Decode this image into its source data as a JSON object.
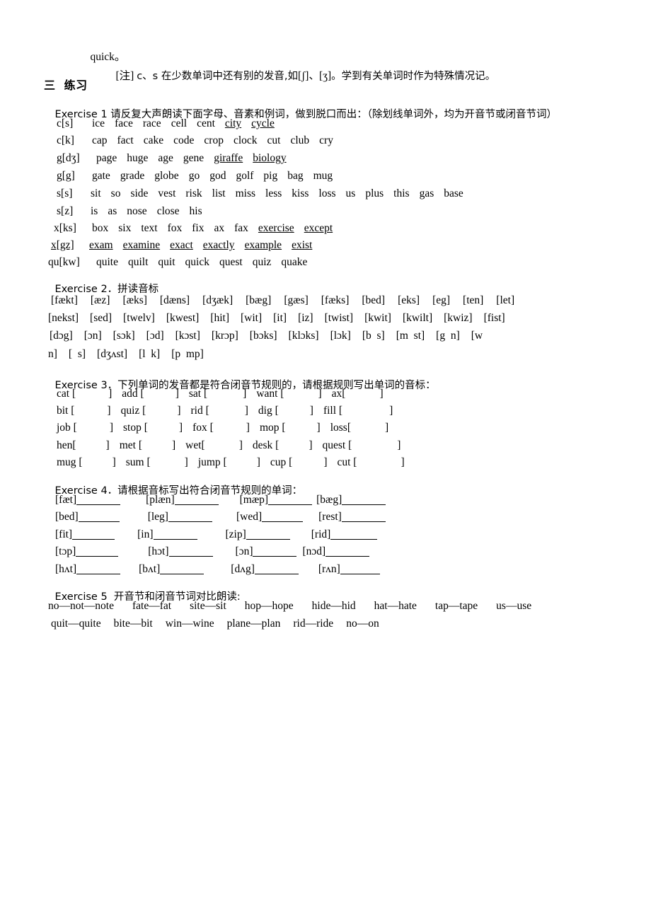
{
  "document": {
    "top_line": "quick。",
    "note": {
      "prefix": "[注] ",
      "text_1": "c、s 在少数单词中还有别的发音,如",
      "symbol_1": "[ʃ]",
      "mid": "、",
      "symbol_2": "[ʒ]",
      "text_2": "。学到有关单词时作为特殊情况记。"
    },
    "section_heading": "三  练习"
  },
  "exercise1": {
    "heading": "Exercise 1 请反复大声朗读下面字母、音素和例词，做到脱口而出：（除划线单词外，均为开音节或闭音节词）",
    "rows": [
      {
        "tag": "c[s]",
        "words": [
          {
            "text": "ice",
            "underline": false
          },
          {
            "text": "face",
            "underline": false
          },
          {
            "text": "race",
            "underline": false
          },
          {
            "text": "cell",
            "underline": false
          },
          {
            "text": "cent",
            "underline": false
          },
          {
            "text": "city",
            "underline": true
          },
          {
            "text": "cycle",
            "underline": true
          }
        ]
      },
      {
        "tag": "c[k]",
        "words": [
          {
            "text": "cap",
            "underline": false
          },
          {
            "text": "fact",
            "underline": false
          },
          {
            "text": "cake",
            "underline": false
          },
          {
            "text": "code",
            "underline": false
          },
          {
            "text": "crop",
            "underline": false
          },
          {
            "text": "clock",
            "underline": false
          },
          {
            "text": "cut",
            "underline": false
          },
          {
            "text": "club",
            "underline": false
          },
          {
            "text": "cry",
            "underline": false
          }
        ]
      },
      {
        "tag": "g[dʒ]",
        "words": [
          {
            "text": "page",
            "underline": false
          },
          {
            "text": "huge",
            "underline": false
          },
          {
            "text": "age",
            "underline": false
          },
          {
            "text": "gene",
            "underline": false
          },
          {
            "text": "giraffe",
            "underline": true
          },
          {
            "text": "biology",
            "underline": true
          }
        ]
      },
      {
        "tag": "g[g]",
        "words": [
          {
            "text": "gate",
            "underline": false
          },
          {
            "text": "grade",
            "underline": false
          },
          {
            "text": "globe",
            "underline": false
          },
          {
            "text": "go",
            "underline": false
          },
          {
            "text": "god",
            "underline": false
          },
          {
            "text": "golf",
            "underline": false
          },
          {
            "text": "pig",
            "underline": false
          },
          {
            "text": "bag",
            "underline": false
          },
          {
            "text": "mug",
            "underline": false
          }
        ]
      },
      {
        "tag": "s[s]",
        "words": [
          {
            "text": "sit",
            "underline": false
          },
          {
            "text": "so",
            "underline": false
          },
          {
            "text": "side",
            "underline": false
          },
          {
            "text": "vest",
            "underline": false
          },
          {
            "text": "risk",
            "underline": false
          },
          {
            "text": "list",
            "underline": false
          },
          {
            "text": "miss",
            "underline": false
          },
          {
            "text": "less",
            "underline": false
          },
          {
            "text": "kiss",
            "underline": false
          },
          {
            "text": "loss",
            "underline": false
          },
          {
            "text": "us",
            "underline": false
          },
          {
            "text": "plus",
            "underline": false
          },
          {
            "text": "this",
            "underline": false
          },
          {
            "text": "gas",
            "underline": false
          },
          {
            "text": "base",
            "underline": false
          }
        ]
      },
      {
        "tag": "s[z]",
        "words": [
          {
            "text": "is",
            "underline": false
          },
          {
            "text": "as",
            "underline": false
          },
          {
            "text": "nose",
            "underline": false
          },
          {
            "text": "close",
            "underline": false
          },
          {
            "text": "his",
            "underline": false
          }
        ]
      },
      {
        "tag": "x[ks]",
        "words": [
          {
            "text": "box",
            "underline": false
          },
          {
            "text": "six",
            "underline": false
          },
          {
            "text": "text",
            "underline": false
          },
          {
            "text": "fox",
            "underline": false
          },
          {
            "text": "fix",
            "underline": false
          },
          {
            "text": "ax",
            "underline": false
          },
          {
            "text": "fax",
            "underline": false
          },
          {
            "text": "exercise",
            "underline": true
          },
          {
            "text": "except",
            "underline": true
          }
        ]
      },
      {
        "tag": "x[gz]",
        "tag_underline": true,
        "words": [
          {
            "text": "exam",
            "underline": true
          },
          {
            "text": "examine",
            "underline": true
          },
          {
            "text": "exact",
            "underline": true
          },
          {
            "text": "exactly",
            "underline": true
          },
          {
            "text": "example",
            "underline": true
          },
          {
            "text": "exist",
            "underline": true
          }
        ]
      },
      {
        "tag": "qu[kw]",
        "words": [
          {
            "text": "quite",
            "underline": false
          },
          {
            "text": "quilt",
            "underline": false
          },
          {
            "text": "quit",
            "underline": false
          },
          {
            "text": "quick",
            "underline": false
          },
          {
            "text": "quest",
            "underline": false
          },
          {
            "text": "quiz",
            "underline": false
          },
          {
            "text": "quake",
            "underline": false
          }
        ]
      }
    ]
  },
  "exercise2": {
    "heading": "Exercise 2．拼读音标",
    "rows": [
      [
        "[fækt]",
        "[æz]",
        "[æks]",
        "[dæns]",
        "[dʒæk]",
        "[bæg]",
        "[gæs]",
        "[fæks]",
        "[bed]",
        "[eks]",
        "[eg]",
        "[ten]",
        "[let]"
      ],
      [
        "[nekst]",
        "[sed]",
        "[twelv]",
        "[kwest]",
        "[hit]",
        "[wit]",
        "[it]",
        "[iz]",
        "[twist]",
        "[kwit]",
        "[kwilt]",
        "[kwiz]",
        "[fist]"
      ],
      [
        "[dɔg]",
        "[ɔn]",
        "[sɔk]",
        "[ɔd]",
        "[kɔst]",
        "[krɔp]",
        "[bɔks]",
        "[klɔks]",
        "[lɔk]",
        "[b  s]",
        "[m  st]",
        "[g  n]",
        "[w"
      ],
      [
        "n]",
        "[  s]",
        "[dʒʌst]",
        "[l  k]",
        "[p  mp]"
      ]
    ]
  },
  "exercise3": {
    "heading": "Exercise 3．下列单词的发音都是符合闭音节规则的，请根据规则写出单词的音标：",
    "rows": [
      [
        {
          "word": "cat [",
          "gap": 46,
          "close": "]"
        },
        {
          "word": "add [",
          "gap": 44,
          "close": "]"
        },
        {
          "word": "sat [",
          "gap": 50,
          "close": "]"
        },
        {
          "word": "want [",
          "gap": 48,
          "close": "]"
        },
        {
          "word": "ax[",
          "gap": 48,
          "close": "]"
        }
      ],
      [
        {
          "word": "bit [",
          "gap": 46,
          "close": "]"
        },
        {
          "word": "quiz [",
          "gap": 44,
          "close": "]"
        },
        {
          "word": "rid [",
          "gap": 50,
          "close": "]"
        },
        {
          "word": "dig [",
          "gap": 44,
          "close": "]"
        },
        {
          "word": "fill [",
          "gap": 66,
          "close": "]"
        }
      ],
      [
        {
          "word": "job [",
          "gap": 46,
          "close": "]"
        },
        {
          "word": "stop [",
          "gap": 44,
          "close": "]"
        },
        {
          "word": "fox [",
          "gap": 46,
          "close": "]"
        },
        {
          "word": "mop [",
          "gap": 44,
          "close": "]"
        },
        {
          "word": "loss[",
          "gap": 48,
          "close": "]"
        }
      ],
      [
        {
          "word": "hen[",
          "gap": 42,
          "close": "]"
        },
        {
          "word": "met [",
          "gap": 42,
          "close": "]"
        },
        {
          "word": "wet[",
          "gap": 48,
          "close": "]"
        },
        {
          "word": "desk [",
          "gap": 42,
          "close": "]"
        },
        {
          "word": "quest [",
          "gap": 64,
          "close": "]"
        }
      ],
      [
        {
          "word": "mug [",
          "gap": 42,
          "close": "]"
        },
        {
          "word": "sum [",
          "gap": 48,
          "close": "]"
        },
        {
          "word": "jump [",
          "gap": 42,
          "close": "]"
        },
        {
          "word": "cup [",
          "gap": 44,
          "close": "]"
        },
        {
          "word": "cut [",
          "gap": 62,
          "close": "]"
        }
      ]
    ]
  },
  "exercise4": {
    "heading": "Exercise 4．请根据音标写出符合闭音节规则的单词：",
    "rows": [
      [
        {
          "sym": "[fæt]",
          "blank": 62,
          "pad": 36
        },
        {
          "sym": "[plæn]",
          "blank": 62,
          "pad": 30
        },
        {
          "sym": "[mæp]",
          "blank": 62,
          "pad": 6
        },
        {
          "sym": "[bæg]",
          "blank": 62,
          "pad": 0
        }
      ],
      [
        {
          "sym": "[bed]",
          "blank": 58,
          "pad": 40
        },
        {
          "sym": "[leg]",
          "blank": 62,
          "pad": 34
        },
        {
          "sym": "[wed]",
          "blank": 58,
          "pad": 22
        },
        {
          "sym": "[rest]",
          "blank": 62,
          "pad": 0
        }
      ],
      [
        {
          "sym": "[fit]",
          "blank": 60,
          "pad": 32
        },
        {
          "sym": "[in]",
          "blank": 62,
          "pad": 40
        },
        {
          "sym": "[zip]",
          "blank": 62,
          "pad": 30
        },
        {
          "sym": "[rid]",
          "blank": 66,
          "pad": 0
        }
      ],
      [
        {
          "sym": "[tɔp]",
          "blank": 60,
          "pad": 42
        },
        {
          "sym": "[hɔt]",
          "blank": 62,
          "pad": 32
        },
        {
          "sym": "[ɔn]",
          "blank": 62,
          "pad": 8
        },
        {
          "sym": "[nɔd]",
          "blank": 62,
          "pad": 0
        }
      ],
      [
        {
          "sym": "[hʌt]",
          "blank": 62,
          "pad": 26
        },
        {
          "sym": "[bʌt]",
          "blank": 62,
          "pad": 38
        },
        {
          "sym": "[dʌg]",
          "blank": 62,
          "pad": 28
        },
        {
          "sym": "[rʌn]",
          "blank": 56,
          "pad": 0
        }
      ]
    ]
  },
  "exercise5": {
    "heading": "Exercise 5  开音节和闭音节词对比朗读:",
    "rows": [
      [
        "no—not—note",
        "fate—fat",
        "site—sit",
        "hop—hope",
        "hide—hid",
        "hat—hate",
        "tap—tape",
        "us—use"
      ],
      [
        "quit—quite",
        "bite—bit",
        "win—wine",
        "plane—plan",
        "rid—ride",
        "no—on"
      ]
    ]
  }
}
